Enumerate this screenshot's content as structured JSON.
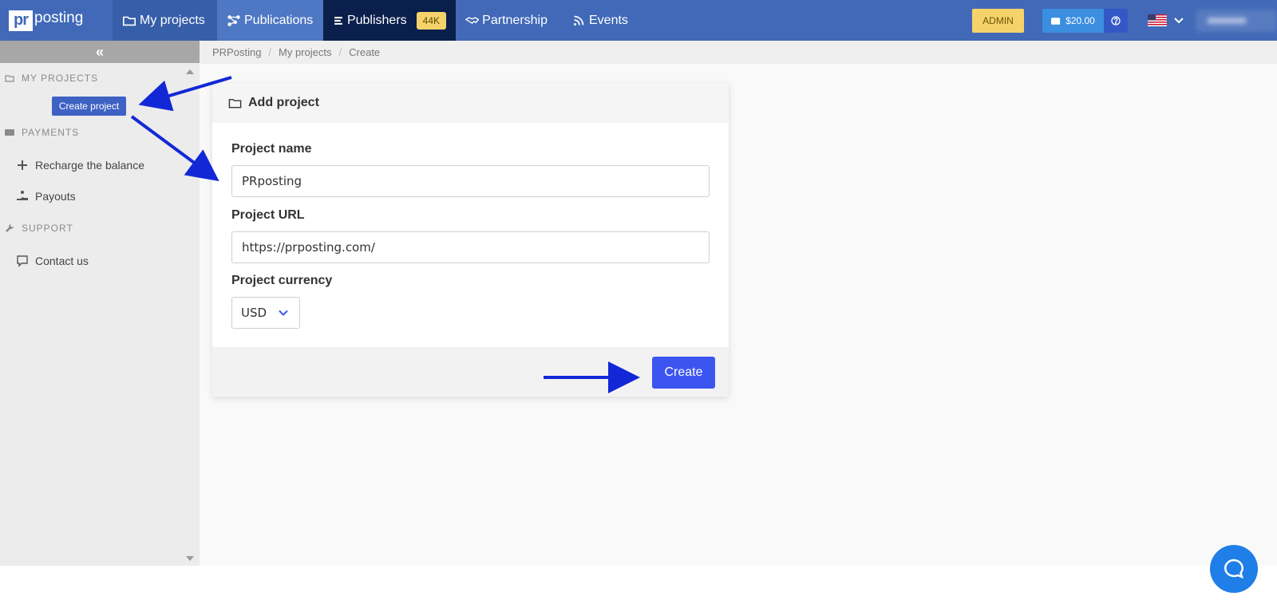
{
  "brand": {
    "logo_mark": "pr",
    "logo_text": "posting"
  },
  "nav": {
    "my_projects": "My projects",
    "publications": "Publications",
    "publishers": "Publishers",
    "publishers_badge": "44K",
    "partnership": "Partnership",
    "events": "Events"
  },
  "topright": {
    "admin_label": "ADMIN",
    "balance": "$20.00"
  },
  "sidebar": {
    "collapse_glyph": "«",
    "section_projects": "MY PROJECTS",
    "create_project": "Create project",
    "section_payments": "PAYMENTS",
    "recharge": "Recharge the balance",
    "payouts": "Payouts",
    "section_support": "SUPPORT",
    "contact": "Contact us"
  },
  "breadcrumb": [
    "PRPosting",
    "My projects",
    "Create"
  ],
  "form": {
    "title": "Add project",
    "name_label": "Project name",
    "name_value": "PRposting",
    "url_label": "Project URL",
    "url_value": "https://prposting.com/",
    "currency_label": "Project currency",
    "currency_value": "USD",
    "submit_label": "Create"
  },
  "colors": {
    "navbar": "#4169b8",
    "publishers_bg": "#0b1f4c",
    "badge": "#f6d36a",
    "primary_button": "#3c55f0",
    "annotation_arrow": "#1228d6",
    "chat": "#1f7ee8"
  },
  "icons": [
    "folder-icon",
    "publications-icon",
    "publishers-icon",
    "handshake-icon",
    "rss-icon",
    "wallet-icon",
    "help-icon",
    "us-flag-icon",
    "chevron-down-icon",
    "plus-icon",
    "payout-icon",
    "wrench-icon",
    "chat-icon"
  ]
}
